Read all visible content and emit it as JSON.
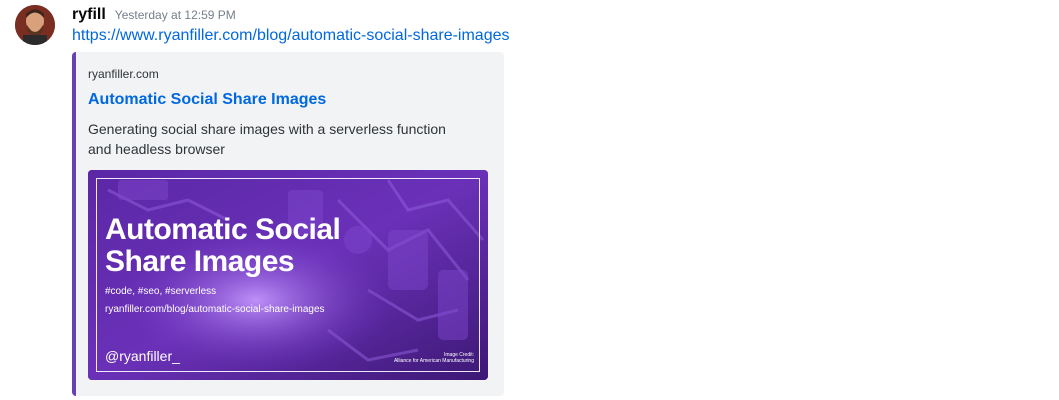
{
  "message": {
    "username": "ryfill",
    "timestamp": "Yesterday at 12:59 PM",
    "link_text": "https://www.ryanfiller.com/blog/automatic-social-share-images"
  },
  "embed": {
    "accent_color": "#6a3fb0",
    "provider": "ryanfiller.com",
    "title": "Automatic Social Share Images",
    "description": "Generating social share images with a serverless function and headless browser",
    "image": {
      "title": "Automatic Social Share Images",
      "tags": "#code,  #seo,  #serverless",
      "url": "ryanfiller.com/blog/automatic-social-share-images",
      "handle": "@ryanfiller_",
      "credit_line1": "Image Credit:",
      "credit_line2": "Alliance for American Manufacturing"
    }
  }
}
